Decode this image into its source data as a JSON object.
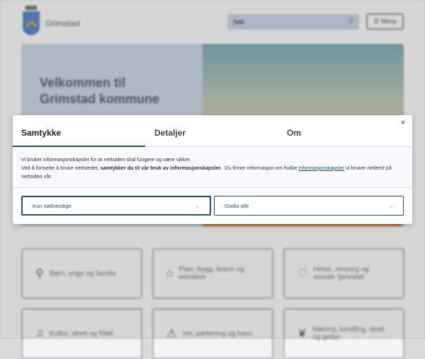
{
  "header": {
    "brand": "Grimstad",
    "search_placeholder": "Søk",
    "menu_label": "☰ Meny"
  },
  "hero": {
    "title_line1": "Velkommen til",
    "title_line2": "Grimstad kommune"
  },
  "cards": [
    {
      "label": "Barn, unge og familie",
      "icon": "person-icon",
      "glyph": "⚲"
    },
    {
      "label": "Plan, bygg, brann og eiendom",
      "icon": "house-icon",
      "glyph": "⌂"
    },
    {
      "label": "Helse, omsorg og sosiale tjenester",
      "icon": "heart-icon",
      "glyph": "♡"
    },
    {
      "label": "Kultur, idrett og fritid",
      "icon": "music-icon",
      "glyph": "♫"
    },
    {
      "label": "Vei, parkering og havn",
      "icon": "warning-icon",
      "glyph": "⚠"
    },
    {
      "label": "Næring, bevilling, skatt og gebyr",
      "icon": "leaf-icon",
      "glyph": "❦"
    }
  ],
  "modal": {
    "tabs": [
      "Samtykke",
      "Detaljer",
      "Om"
    ],
    "close": "×",
    "line1": "Vi bruker informasjonskapsler for at nettsiden skal fungere og være sikker.",
    "line2_pre": "Ved å fortsette å bruke nettstedet, ",
    "line2_bold": "samtykker du til vår bruk av informasjonskapsler.",
    "line2_mid": "  Du finner informasjon om hvilke ",
    "line2_link": "informasjonskapsler",
    "line2_post": " vi bruker nederst på nettsiden vår.",
    "btn_necessary": "Kun nødvendige",
    "btn_accept": "Godta alle",
    "arrow": "→"
  }
}
